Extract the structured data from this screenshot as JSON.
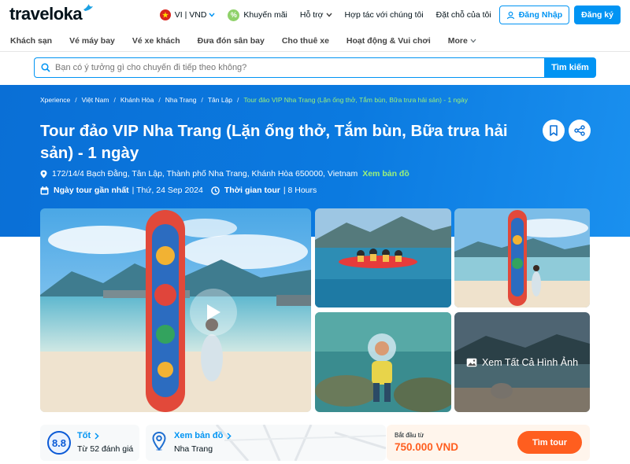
{
  "header": {
    "logo_text": "traveloka",
    "language_currency": "VI | VND",
    "promotions": "Khuyến mãi",
    "support": "Hỗ trợ",
    "partner": "Hợp tác với chúng tôi",
    "bookings": "Đặt chỗ của tôi",
    "login": "Đăng Nhập",
    "register": "Đăng ký"
  },
  "nav": {
    "items": [
      "Khách sạn",
      "Vé máy bay",
      "Vé xe khách",
      "Đưa đón sân bay",
      "Cho thuê xe",
      "Hoạt động & Vui chơi",
      "More"
    ]
  },
  "search": {
    "placeholder": "Bạn có ý tưởng gì cho chuyến đi tiếp theo không?",
    "button": "Tìm kiếm"
  },
  "breadcrumb": [
    "Xperience",
    "Việt Nam",
    "Khánh Hòa",
    "Nha Trang",
    "Tân Lập",
    "Tour đảo VIP Nha Trang (Lặn ống thở, Tắm bùn, Bữa trưa hải sản) - 1 ngày"
  ],
  "tour": {
    "title": "Tour đảo VIP Nha Trang (Lặn ống thở, Tắm bùn, Bữa trưa hải sản) - 1 ngày",
    "address": "172/14/4 Bạch Đằng, Tân Lập, Thành phố Nha Trang, Khánh Hòa 650000, Vietnam",
    "map_link": "Xem bản đồ",
    "next_date_label": "Ngày tour gần nhất",
    "next_date_value": "| Thứ, 24 Sep 2024",
    "duration_label": "Thời gian tour",
    "duration_value": "| 8 Hours"
  },
  "gallery": {
    "see_all": "Xem Tất Cả Hình Ảnh"
  },
  "rating": {
    "score": "8.8",
    "label": "Tốt",
    "count": "Từ 52 đánh giá"
  },
  "location": {
    "link": "Xem bản đồ",
    "city": "Nha Trang"
  },
  "price": {
    "from_label": "Bắt đầu từ",
    "value": "750.000 VND",
    "button": "Tìm tour"
  },
  "colors": {
    "brand_blue": "#0194f3",
    "hero_blue": "#0b7ae0",
    "highlight_green": "#9bf27a",
    "orange": "#ff5e1f"
  }
}
